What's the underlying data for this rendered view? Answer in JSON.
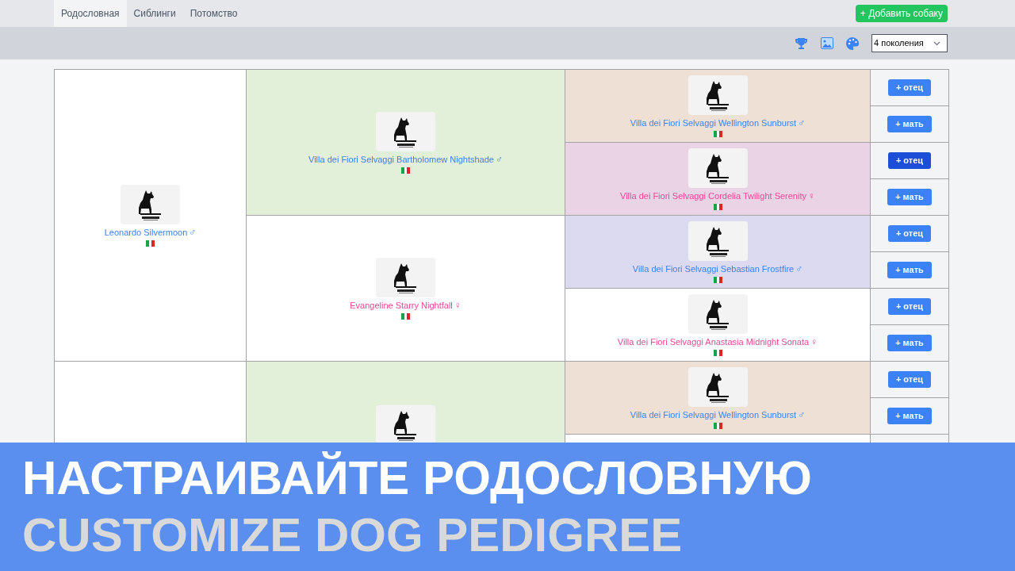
{
  "tabs": [
    {
      "label": "Родословная",
      "selected": true
    },
    {
      "label": "Сиблинги",
      "selected": false
    },
    {
      "label": "Потомство",
      "selected": false
    }
  ],
  "add_button": "+ Добавить собаку",
  "toolbar": {
    "generations": "4 поколения"
  },
  "pedigree": [
    {
      "cell": {
        "color": "#ffffff"
      },
      "dog": {
        "name": "Leonardo Silvermoon",
        "sex_sign": "♂",
        "color": "#3b82f6",
        "photo": true
      },
      "parents": [
        {
          "cell": {
            "color": "#e2efd9"
          },
          "dog": {
            "name": "Villa dei Fiori Selvaggi Bartholomew Nightshade",
            "sex_sign": "♂",
            "color": "#3b82f6",
            "photo": true
          },
          "parents": [
            {
              "cell": {
                "color": "#efe0d6"
              },
              "dog": {
                "name": "Villa dei Fiori Selvaggi Wellington Sunburst",
                "sex_sign": "♂",
                "color": "#3b82f6",
                "photo": true
              },
              "buttons": [
                {
                  "label": "+ отец",
                  "focused": false
                },
                {
                  "label": "+ мать",
                  "focused": false
                }
              ]
            },
            {
              "cell": {
                "color": "#ead3e4"
              },
              "dog": {
                "name": "Villa dei Fiori Selvaggi Cordelia Twilight Serenity",
                "sex_sign": "♀",
                "color": "#ec4899",
                "photo": true
              },
              "buttons": [
                {
                  "label": "+ отец",
                  "focused": true
                },
                {
                  "label": "+ мать",
                  "focused": false
                }
              ]
            }
          ]
        },
        {
          "cell": {
            "color": "#ffffff"
          },
          "dog": {
            "name": "Evangeline Starry Nightfall",
            "sex_sign": "♀",
            "color": "#ec4899",
            "photo": true
          },
          "parents": [
            {
              "cell": {
                "color": "#dcdaf0"
              },
              "dog": {
                "name": "Villa dei Fiori Selvaggi Sebastian Frostfire",
                "sex_sign": "♂",
                "color": "#3b82f6",
                "photo": true
              },
              "buttons": [
                {
                  "label": "+ отец",
                  "focused": false
                },
                {
                  "label": "+ мать",
                  "focused": false
                }
              ]
            },
            {
              "cell": {
                "color": "#ffffff"
              },
              "dog": {
                "name": "Villa dei Fiori Selvaggi Anastasia Midnight Sonata",
                "sex_sign": "♀",
                "color": "#ec4899",
                "photo": true
              },
              "buttons": [
                {
                  "label": "+ отец",
                  "focused": false
                },
                {
                  "label": "+ мать",
                  "focused": false
                }
              ]
            }
          ]
        }
      ]
    },
    {
      "cell": {
        "color": "#ffffff"
      },
      "dog": {
        "photo": false
      },
      "parents": [
        {
          "cell": {
            "color": "#e2efd9"
          },
          "dog": {
            "photo": true
          },
          "parents": [
            {
              "cell": {
                "color": "#efe0d6"
              },
              "dog": {
                "name": "Villa dei Fiori Selvaggi Wellington Sunburst",
                "sex_sign": "♂",
                "color": "#3b82f6",
                "photo": true
              },
              "buttons": [
                {
                  "label": "+ отец",
                  "focused": false
                },
                {
                  "label": "+ мать",
                  "focused": false
                }
              ]
            }
          ]
        }
      ]
    }
  ],
  "banner": {
    "title": "НАСТРАИВАЙТЕ РОДОСЛОВНУЮ",
    "subtitle": "CUSTOMIZE DOG PEDIGREE"
  }
}
